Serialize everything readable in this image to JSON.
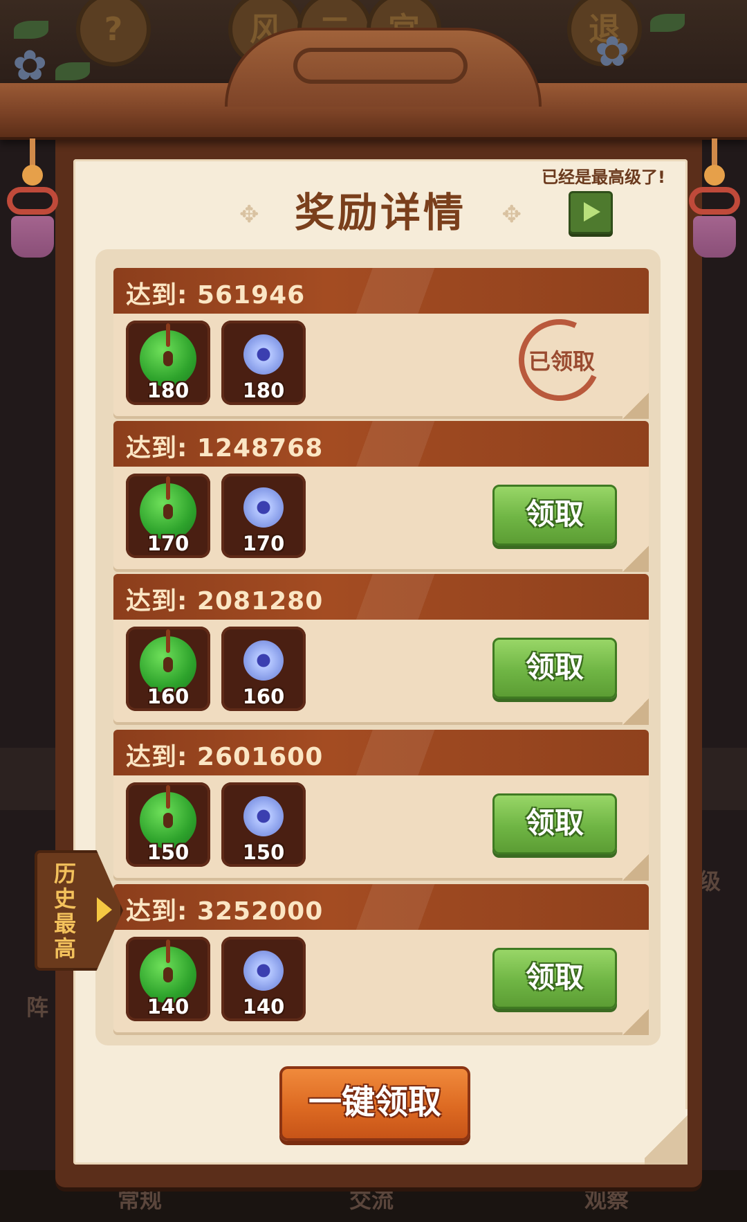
{
  "background": {
    "top_buttons": [
      "?",
      "风",
      "二",
      "宫",
      "退"
    ],
    "bottom_labels": [
      "常规",
      "交流",
      "观察"
    ],
    "side_left_text": "阵",
    "side_right_text": "级"
  },
  "panel": {
    "title": "奖励详情",
    "max_level_note": "已经是最高级了!"
  },
  "rewards": [
    {
      "threshold_label": "达到: 561946",
      "items": [
        {
          "icon": "green-jade-coin-icon",
          "count": "180"
        },
        {
          "icon": "blue-gem-icon",
          "count": "180"
        }
      ],
      "status": "claimed",
      "claimed_label": "已领取"
    },
    {
      "threshold_label": "达到: 1248768",
      "items": [
        {
          "icon": "green-jade-coin-icon",
          "count": "170"
        },
        {
          "icon": "blue-gem-icon",
          "count": "170"
        }
      ],
      "status": "claimable",
      "button_label": "领取"
    },
    {
      "threshold_label": "达到: 2081280",
      "items": [
        {
          "icon": "green-jade-coin-icon",
          "count": "160"
        },
        {
          "icon": "blue-gem-icon",
          "count": "160"
        }
      ],
      "status": "claimable",
      "button_label": "领取"
    },
    {
      "threshold_label": "达到: 2601600",
      "items": [
        {
          "icon": "green-jade-coin-icon",
          "count": "150"
        },
        {
          "icon": "blue-gem-icon",
          "count": "150"
        }
      ],
      "status": "claimable",
      "button_label": "领取"
    },
    {
      "threshold_label": "达到: 3252000",
      "items": [
        {
          "icon": "green-jade-coin-icon",
          "count": "140"
        },
        {
          "icon": "blue-gem-icon",
          "count": "140"
        }
      ],
      "status": "claimable",
      "button_label": "领取"
    }
  ],
  "claim_all_label": "一键领取",
  "history_tab_label": "历史最高",
  "colors": {
    "header_bar": "#a44c22",
    "claim_button": "#6fb544",
    "claim_all_button": "#dd6a22",
    "paper": "#f6ecd9"
  }
}
